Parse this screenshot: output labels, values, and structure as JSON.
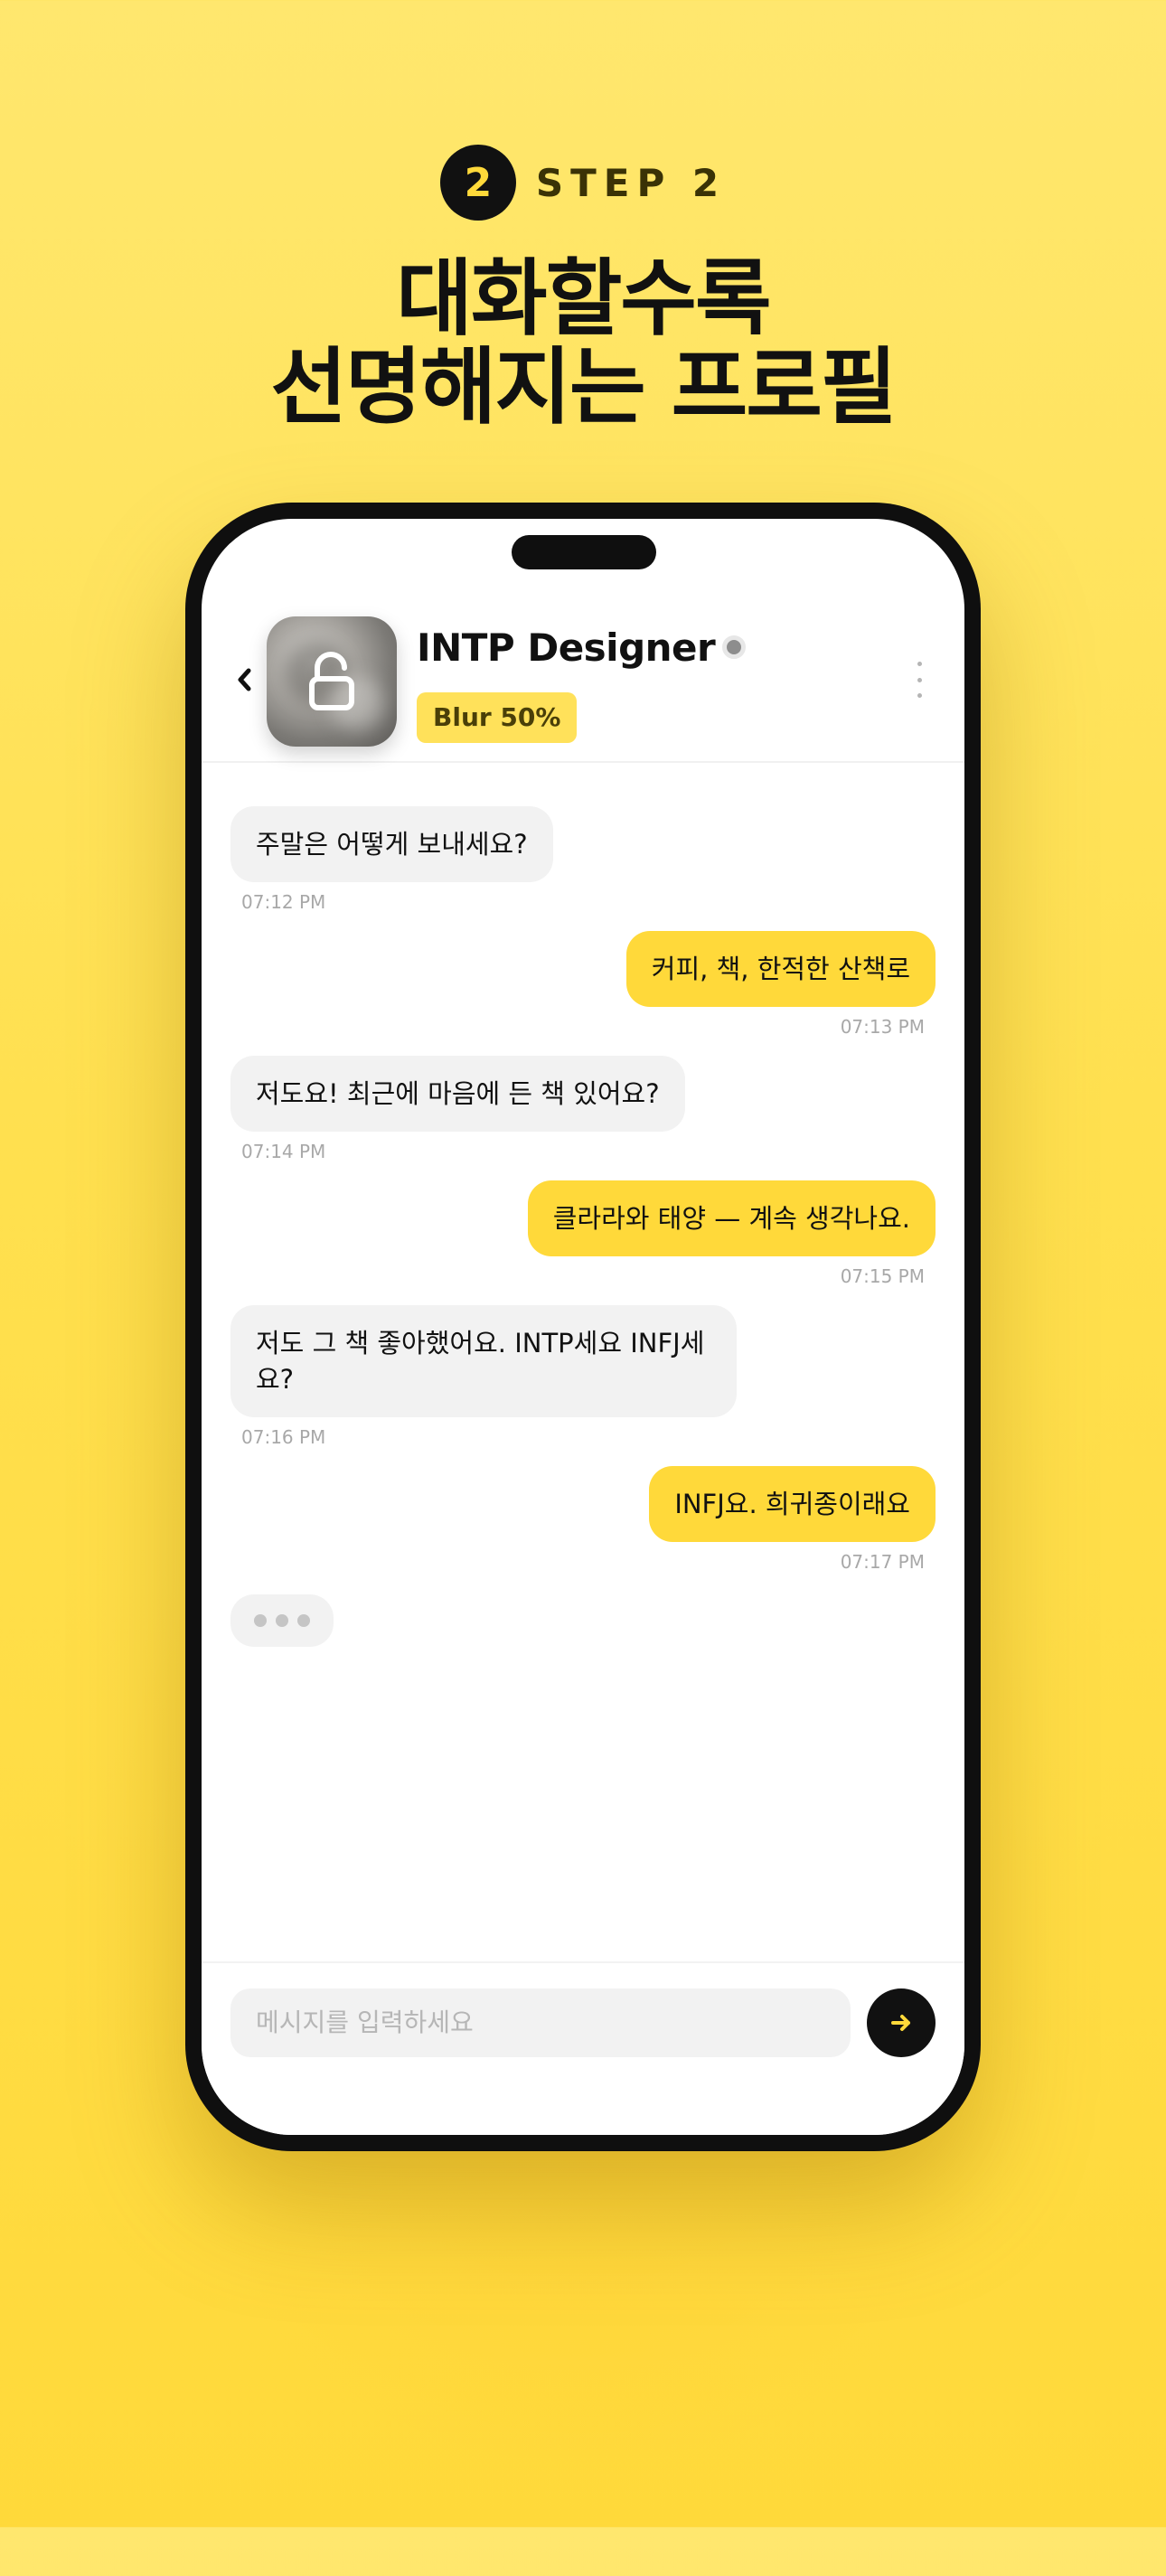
{
  "step": {
    "number": "2",
    "label": "STEP 2"
  },
  "headline": {
    "line1": "대화할수록",
    "line2": "선명해지는 프로필"
  },
  "chat": {
    "back_icon": "chevron-left-icon",
    "avatar_icon": "unlock-icon",
    "name": "INTP Designer",
    "blur_label": "Blur 50%",
    "more_icon": "vertical-dots-icon",
    "messages": [
      {
        "side": "in",
        "text": "주말은 어떻게 보내세요?",
        "time": "07:12 PM"
      },
      {
        "side": "out",
        "text": "커피, 책, 한적한 산책로",
        "time": "07:13 PM"
      },
      {
        "side": "in",
        "text": "저도요! 최근에 마음에 든 책 있어요?",
        "time": "07:14 PM"
      },
      {
        "side": "out",
        "text": "클라라와 태양 — 계속 생각나요.",
        "time": "07:15 PM"
      },
      {
        "side": "in",
        "text": "저도 그 책 좋아했어요. INTP세요 INFJ세요?",
        "time": "07:16 PM"
      },
      {
        "side": "out",
        "text": "INFJ요. 희귀종이래요",
        "time": "07:17 PM"
      }
    ],
    "typing_indicator": true
  },
  "composer": {
    "placeholder": "메시지를 입력하세요",
    "send_icon": "arrow-right-icon"
  },
  "colors": {
    "accent": "#FFD93A",
    "dark": "#111111",
    "bubble_in": "#F2F2F2",
    "badge": "#FFE15A"
  }
}
